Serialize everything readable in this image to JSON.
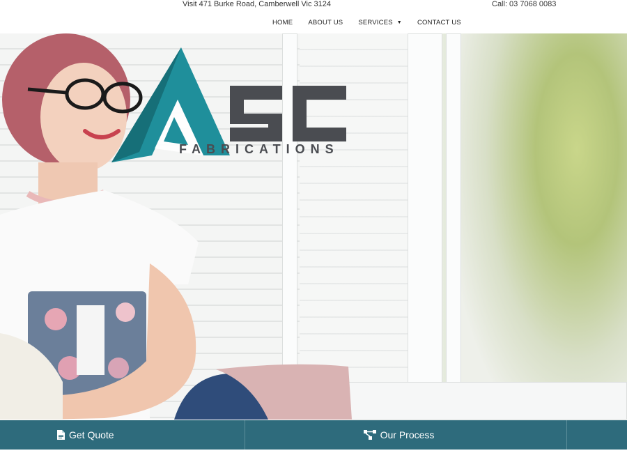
{
  "topbar": {
    "address": "Visit 471 Burke Road, Camberwell Vic 3124",
    "phone": "Call: 03 7068 0083"
  },
  "nav": {
    "items": [
      {
        "label": "HOME"
      },
      {
        "label": "ABOUT US"
      },
      {
        "label": "SERVICES",
        "has_dropdown": true
      },
      {
        "label": "CONTACT US"
      }
    ]
  },
  "logo": {
    "letters": "SC",
    "subtitle": "FABRICATIONS",
    "brand_color": "#1f8f9b",
    "text_color": "#4a4c51"
  },
  "bottombar": {
    "quote_label": "Get Quote",
    "process_label": "Our Process",
    "color": "#2e6b7c"
  },
  "icons": {
    "quote": "document-icon",
    "process": "flowchart-icon"
  }
}
